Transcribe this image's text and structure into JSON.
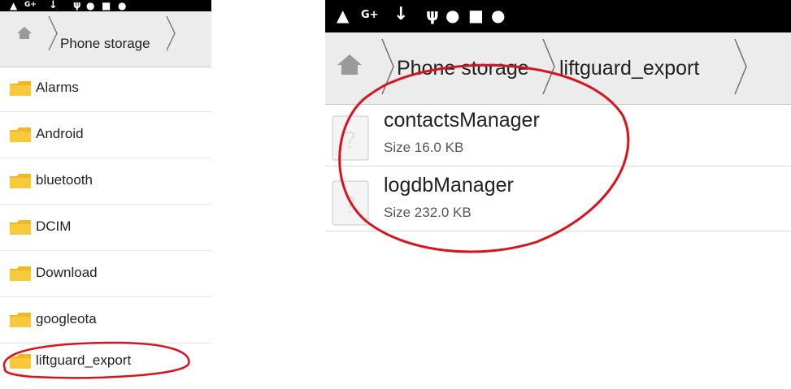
{
  "left_panel": {
    "breadcrumb": {
      "path": "Phone storage"
    },
    "folders": [
      {
        "name": "Alarms"
      },
      {
        "name": "Android"
      },
      {
        "name": "bluetooth"
      },
      {
        "name": "DCIM"
      },
      {
        "name": "Download"
      },
      {
        "name": "googleota"
      },
      {
        "name": "liftguard_export"
      }
    ]
  },
  "right_panel": {
    "breadcrumb": {
      "root": "Phone storage",
      "current": "liftguard_export"
    },
    "files": [
      {
        "name": "contactsManager",
        "size": "Size 16.0 KB"
      },
      {
        "name": "logdbManager",
        "size": "Size 232.0 KB"
      }
    ]
  },
  "status_icons": [
    "keyhole-icon",
    "google-plus-icon",
    "download-icon",
    "usb-icon",
    "alert-icon",
    "clipboard-check-icon",
    "android-icon"
  ],
  "colors": {
    "annotation": "#d8131b",
    "folder": "#f2b823",
    "status_bar": "#000000",
    "breadcrumb_bg": "#ececec"
  }
}
